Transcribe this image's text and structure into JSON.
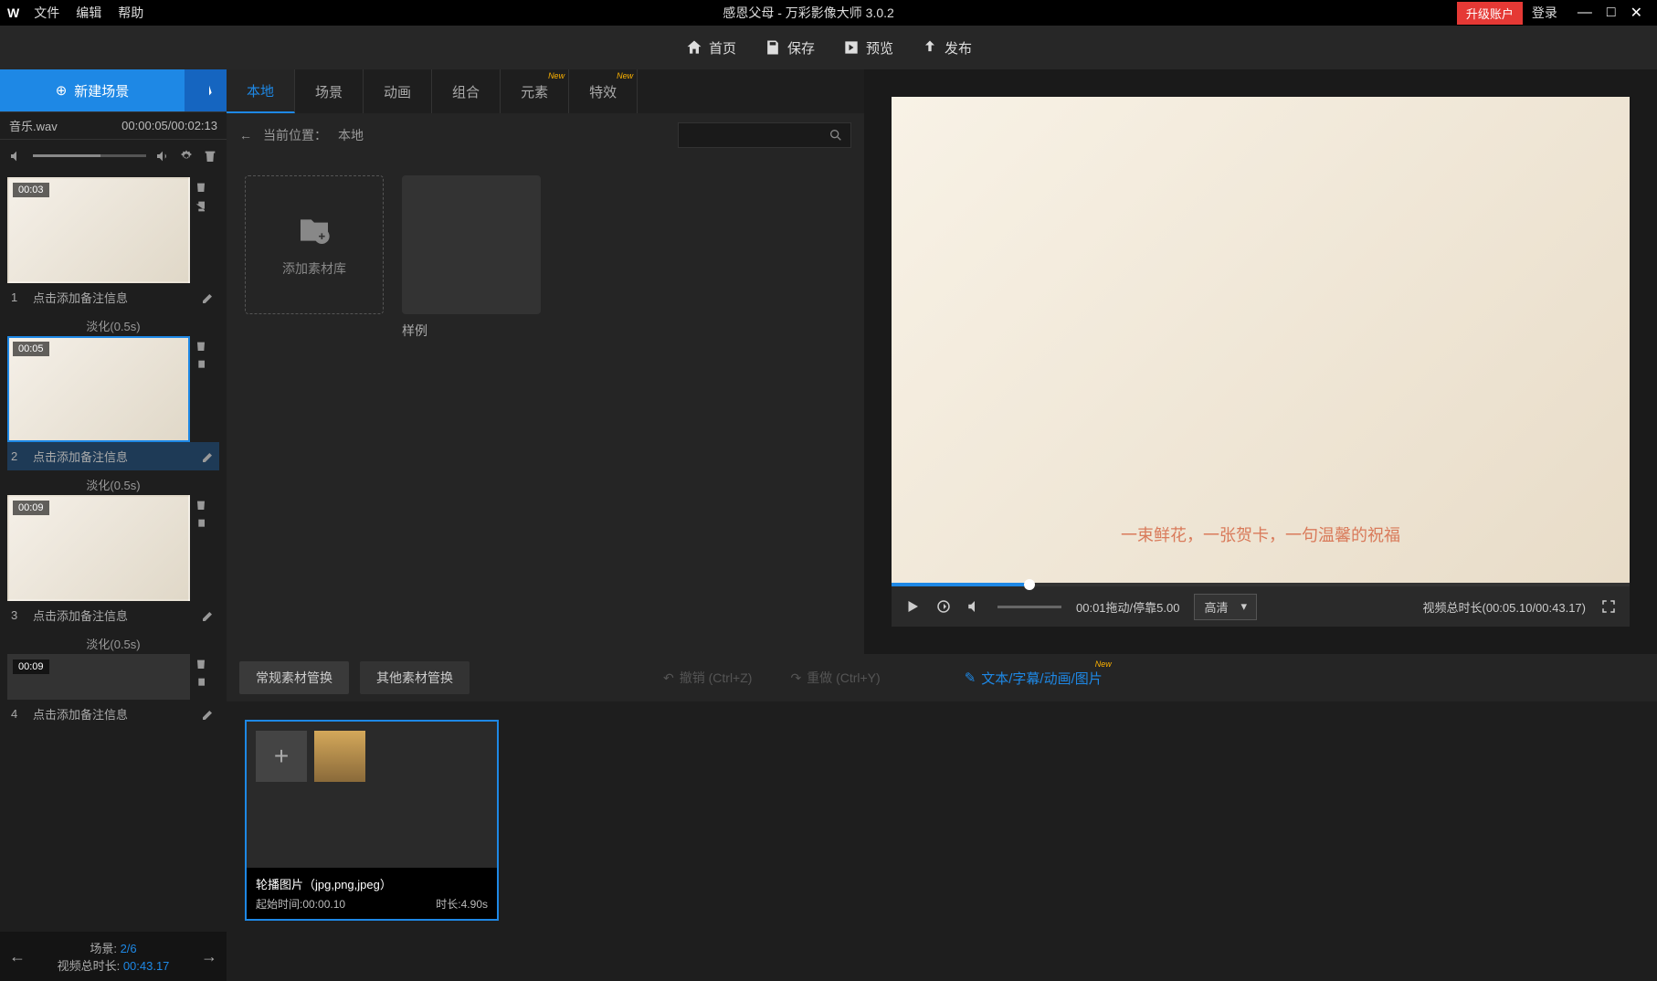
{
  "titlebar": {
    "menus": [
      "文件",
      "编辑",
      "帮助"
    ],
    "title": "感恩父母 - 万彩影像大师 3.0.2",
    "upgrade": "升级账户",
    "login": "登录"
  },
  "toolbar": {
    "home": "首页",
    "save": "保存",
    "preview": "预览",
    "publish": "发布"
  },
  "sidebar": {
    "new_scene": "新建场景",
    "audio_name": "音乐.wav",
    "audio_time": "00:00:05/00:02:13",
    "scenes": [
      {
        "idx": "1",
        "dur": "00:03",
        "note": "点击添加备注信息"
      },
      {
        "idx": "2",
        "dur": "00:05",
        "note": "点击添加备注信息",
        "active": true
      },
      {
        "idx": "3",
        "dur": "00:09",
        "note": "点击添加备注信息"
      },
      {
        "idx": "4",
        "dur": "00:09",
        "note": "点击添加备注信息"
      }
    ],
    "transition": "淡化(0.5s)",
    "footer": {
      "scene_label": "场景:",
      "scene_val": "2/6",
      "total_label": "视频总时长:",
      "total_val": "00:43.17"
    }
  },
  "assets": {
    "tabs": [
      "本地",
      "场景",
      "动画",
      "组合",
      "元素",
      "特效"
    ],
    "path_label": "当前位置：",
    "path_val": "本地",
    "add_lib": "添加素材库",
    "sample": "样例"
  },
  "preview": {
    "caption": "一束鲜花，一张贺卡，一句温馨的祝福",
    "time": "00:01拖动/停靠5.00",
    "quality": "高清",
    "total_label": "视频总时长(00:05.10/00:43.17)"
  },
  "lower": {
    "tab1": "常规素材管换",
    "tab2": "其他素材管换",
    "undo": "撤销 (Ctrl+Z)",
    "redo": "重做 (Ctrl+Y)",
    "text_edit": "文本/字幕/动画/图片",
    "clip_title": "轮播图片（jpg,png,jpeg）",
    "clip_start": "起始时间:00:00.10",
    "clip_dur": "时长:4.90s"
  }
}
